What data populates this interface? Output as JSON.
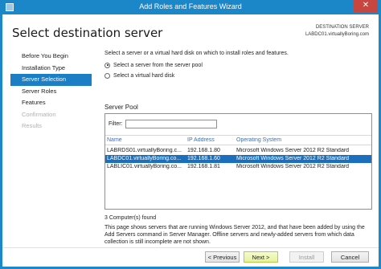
{
  "window": {
    "title": "Add Roles and Features Wizard",
    "close_glyph": "✕"
  },
  "header": {
    "page_title": "Select destination server",
    "destination_label": "DESTINATION SERVER",
    "destination_value": "LABDC01.virtuallyBoring.com"
  },
  "nav": {
    "items": [
      {
        "label": "Before You Begin"
      },
      {
        "label": "Installation Type"
      },
      {
        "label": "Server Selection"
      },
      {
        "label": "Server Roles"
      },
      {
        "label": "Features"
      },
      {
        "label": "Confirmation"
      },
      {
        "label": "Results"
      }
    ]
  },
  "content": {
    "intro": "Select a server or a virtual hard disk on which to install roles and features.",
    "option_pool": "Select a server from the server pool",
    "option_vhd": "Select a virtual hard disk",
    "pool_label": "Server Pool",
    "filter_label": "Filter:",
    "filter_value": "",
    "columns": [
      "Name",
      "IP Address",
      "Operating System"
    ],
    "rows": [
      {
        "name": "LABRDS01.virtuallyBoring.c...",
        "ip": "192.168.1.80",
        "os": "Microsoft Windows Server 2012 R2 Standard"
      },
      {
        "name": "LABDC01.virtuallyBoring.co...",
        "ip": "192.168.1.60",
        "os": "Microsoft Windows Server 2012 R2 Standard"
      },
      {
        "name": "LABLIC01.virtuallyBoring.co...",
        "ip": "192.168.1.81",
        "os": "Microsoft Windows Server 2012 R2 Standard"
      }
    ],
    "count": "3 Computer(s) found",
    "description": "This page shows servers that are running Windows Server 2012, and that have been added by using the Add Servers command in Server Manager. Offline servers and newly-added servers from which data collection is still incomplete are not shown."
  },
  "footer": {
    "previous": "< Previous",
    "next": "Next >",
    "install": "Install",
    "cancel": "Cancel"
  },
  "colors": {
    "accent": "#1c7ec4",
    "titlebar": "#1b86c8",
    "selection": "#1c6fbd",
    "close": "#c7463f"
  }
}
